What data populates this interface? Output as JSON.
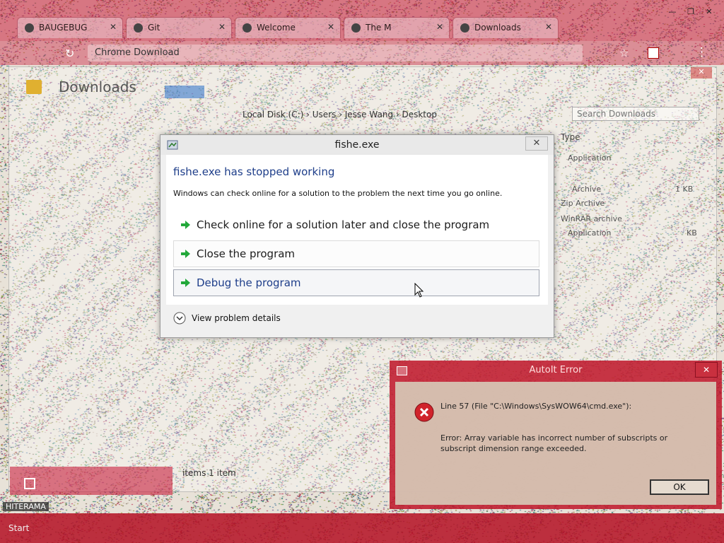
{
  "browser": {
    "tabs": [
      {
        "label": "BAUGEBUG"
      },
      {
        "label": "Git"
      },
      {
        "label": "Welcome"
      },
      {
        "label": "The M"
      },
      {
        "label": "Downloads"
      }
    ],
    "address_text": "Chrome Download",
    "window_buttons": [
      "—",
      "❐",
      "✕"
    ]
  },
  "explorer": {
    "title": "Downloads",
    "path_text": "Local Disk (C:) › Users › Jesse Wang › Desktop",
    "search_placeholder": "Search Downloads",
    "column_type": "Type",
    "file_types": [
      "Application",
      "Archive",
      "1 KB",
      "Zip Archive",
      "WinRAR archive",
      "Application",
      "KB"
    ],
    "status_text": "items   1 item"
  },
  "dialog": {
    "title": "fishe.exe",
    "heading": "fishe.exe has stopped working",
    "description": "Windows can check online for a solution to the problem the next time you go online.",
    "options": [
      {
        "label": "Check online for a solution later and close the program"
      },
      {
        "label": "Close the program"
      },
      {
        "label": "Debug the program"
      }
    ],
    "details_label": "View problem details",
    "close_glyph": "✕"
  },
  "autoit_error": {
    "title": "AutoIt Error",
    "line_text": "Line 57  (File \"C:\\Windows\\SysWOW64\\cmd.exe\"):",
    "message": "Error: Array variable has incorrect number of subscripts or subscript dimension range exceeded.",
    "ok_label": "OK",
    "close_glyph": "✕"
  },
  "taskbar": {
    "start_label": "Start",
    "bottom_label": "HITERAMA"
  },
  "colors": {
    "chrome_red": "#c81e3c",
    "heading_blue": "#1e3e8a",
    "error_red": "#d0232b",
    "arrow_green": "#22a83a"
  }
}
